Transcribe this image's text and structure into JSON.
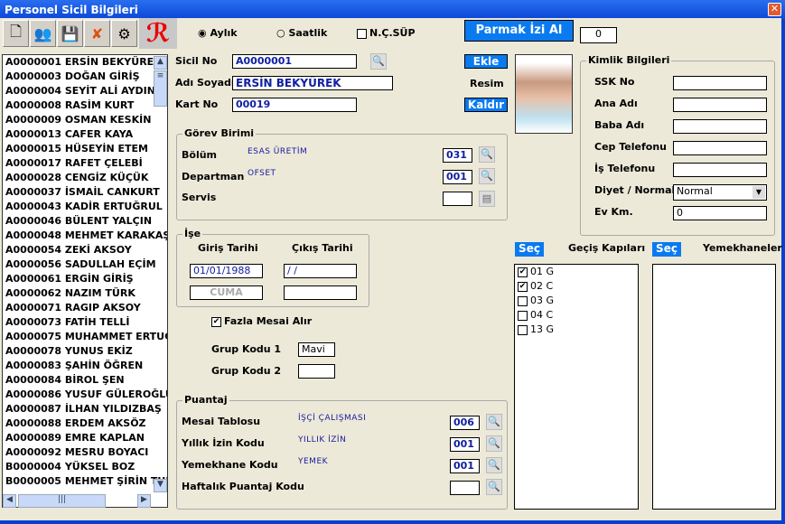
{
  "window": {
    "title": "Personel Sicil Bilgileri"
  },
  "toolbar": {
    "icons": [
      "new-document-icon",
      "users-icon",
      "save-icon",
      "delete-icon",
      "tools-icon",
      "logo-icon"
    ]
  },
  "pay_type": {
    "options": [
      "Aylık",
      "Saatlik"
    ],
    "selected": "Aylık"
  },
  "ncsup": {
    "label": "N.Ç.SÜP",
    "checked": false
  },
  "fingerprint": {
    "label": "Parmak İzi Al",
    "value": "0"
  },
  "employees": [
    [
      "A0000001",
      "ERSİN BEKYÜREK"
    ],
    [
      "A0000003",
      "DOĞAN GİRİŞ"
    ],
    [
      "A0000004",
      "SEYİT ALİ AYDIN"
    ],
    [
      "A0000008",
      "RASİM KURT"
    ],
    [
      "A0000009",
      "OSMAN KESKİN"
    ],
    [
      "A0000013",
      "CAFER KAYA"
    ],
    [
      "A0000015",
      "HÜSEYİN ETEM"
    ],
    [
      "A0000017",
      "RAFET ÇELEBİ"
    ],
    [
      "A0000028",
      "CENGİZ KÜÇÜK"
    ],
    [
      "A0000037",
      "İSMAİL CANKURT"
    ],
    [
      "A0000043",
      "KADİR ERTUĞRUL"
    ],
    [
      "A0000046",
      "BÜLENT YALÇIN"
    ],
    [
      "A0000048",
      "MEHMET KARAKAŞ"
    ],
    [
      "A0000054",
      "ZEKİ AKSOY"
    ],
    [
      "A0000056",
      "SADULLAH EÇİM"
    ],
    [
      "A0000061",
      "ERGİN GİRİŞ"
    ],
    [
      "A0000062",
      "NAZIM TÜRK"
    ],
    [
      "A0000071",
      "RAGIP AKSOY"
    ],
    [
      "A0000073",
      "FATİH TELLİ"
    ],
    [
      "A0000075",
      "MUHAMMET ERTUĞ"
    ],
    [
      "A0000078",
      "YUNUS EKİZ"
    ],
    [
      "A0000083",
      "ŞAHİN ÖĞREN"
    ],
    [
      "A0000084",
      "BİROL ŞEN"
    ],
    [
      "A0000086",
      "YUSUF GÜLEROĞLU"
    ],
    [
      "A0000087",
      "İLHAN YILDIZBAŞ"
    ],
    [
      "A0000088",
      "ERDEM AKSÖZ"
    ],
    [
      "A0000089",
      "EMRE KAPLAN"
    ],
    [
      "A0000092",
      "MESRU BOYACI"
    ],
    [
      "B0000004",
      "YÜKSEL BOZ"
    ],
    [
      "B0000005",
      "MEHMET ŞİRİN TUR"
    ]
  ],
  "form": {
    "sicil_label": "Sicil No",
    "sicil": "A0000001",
    "name_label": "Adı Soyadı",
    "name": "ERSİN BEKYÜREK",
    "card_label": "Kart No",
    "card": "00019",
    "add": "Ekle",
    "remove": "Kaldır",
    "photo_label": "Resim"
  },
  "gorev": {
    "title": "Görev Birimi",
    "bolum_label": "Bölüm",
    "bolum_name": "ESAS ÜRETİM",
    "bolum_code": "031",
    "dep_label": "Departman",
    "dep_name": "OFSET",
    "dep_code": "001",
    "servis_label": "Servis",
    "servis_code": ""
  },
  "ise": {
    "title": "İşe",
    "giris_label": "Giriş Tarihi",
    "cikis_label": "Çıkış Tarihi",
    "giris": "01/01/1988",
    "cikis": " /  /",
    "giris_day": "CUMA",
    "cikis_day": ""
  },
  "overtime": {
    "label": "Fazla Mesai Alır",
    "checked": true
  },
  "group1": {
    "label": "Grup Kodu 1",
    "value": "Mavi"
  },
  "group2": {
    "label": "Grup Kodu 2",
    "value": ""
  },
  "puantaj": {
    "title": "Puantaj",
    "rows": [
      {
        "label": "Mesai Tablosu",
        "name": "İŞÇİ ÇALIŞMASI",
        "code": "006"
      },
      {
        "label": "Yıllık İzin Kodu",
        "name": "YILLIK İZİN",
        "code": "001"
      },
      {
        "label": "Yemekhane Kodu",
        "name": "YEMEK",
        "code": "001"
      },
      {
        "label": "Haftalık Puantaj Kodu",
        "name": "",
        "code": ""
      }
    ]
  },
  "kimlik": {
    "title": "Kimlik Bilgileri",
    "fields": [
      {
        "label": "SSK No",
        "value": ""
      },
      {
        "label": "Ana Adı",
        "value": ""
      },
      {
        "label": "Baba Adı",
        "value": ""
      },
      {
        "label": "Cep Telefonu",
        "value": ""
      },
      {
        "label": "İş Telefonu",
        "value": ""
      }
    ],
    "diet_label": "Diyet / Normal",
    "diet": "Normal",
    "km_label": "Ev Km.",
    "km": "0"
  },
  "gates": {
    "select": "Seç",
    "title": "Geçiş Kapıları",
    "items": [
      {
        "label": "01  G",
        "checked": true
      },
      {
        "label": "02  C",
        "checked": true
      },
      {
        "label": "03  G",
        "checked": false
      },
      {
        "label": "04  C",
        "checked": false
      },
      {
        "label": "13  G",
        "checked": false
      }
    ]
  },
  "cafeterias": {
    "select": "Seç",
    "title": "Yemekhaneler"
  }
}
